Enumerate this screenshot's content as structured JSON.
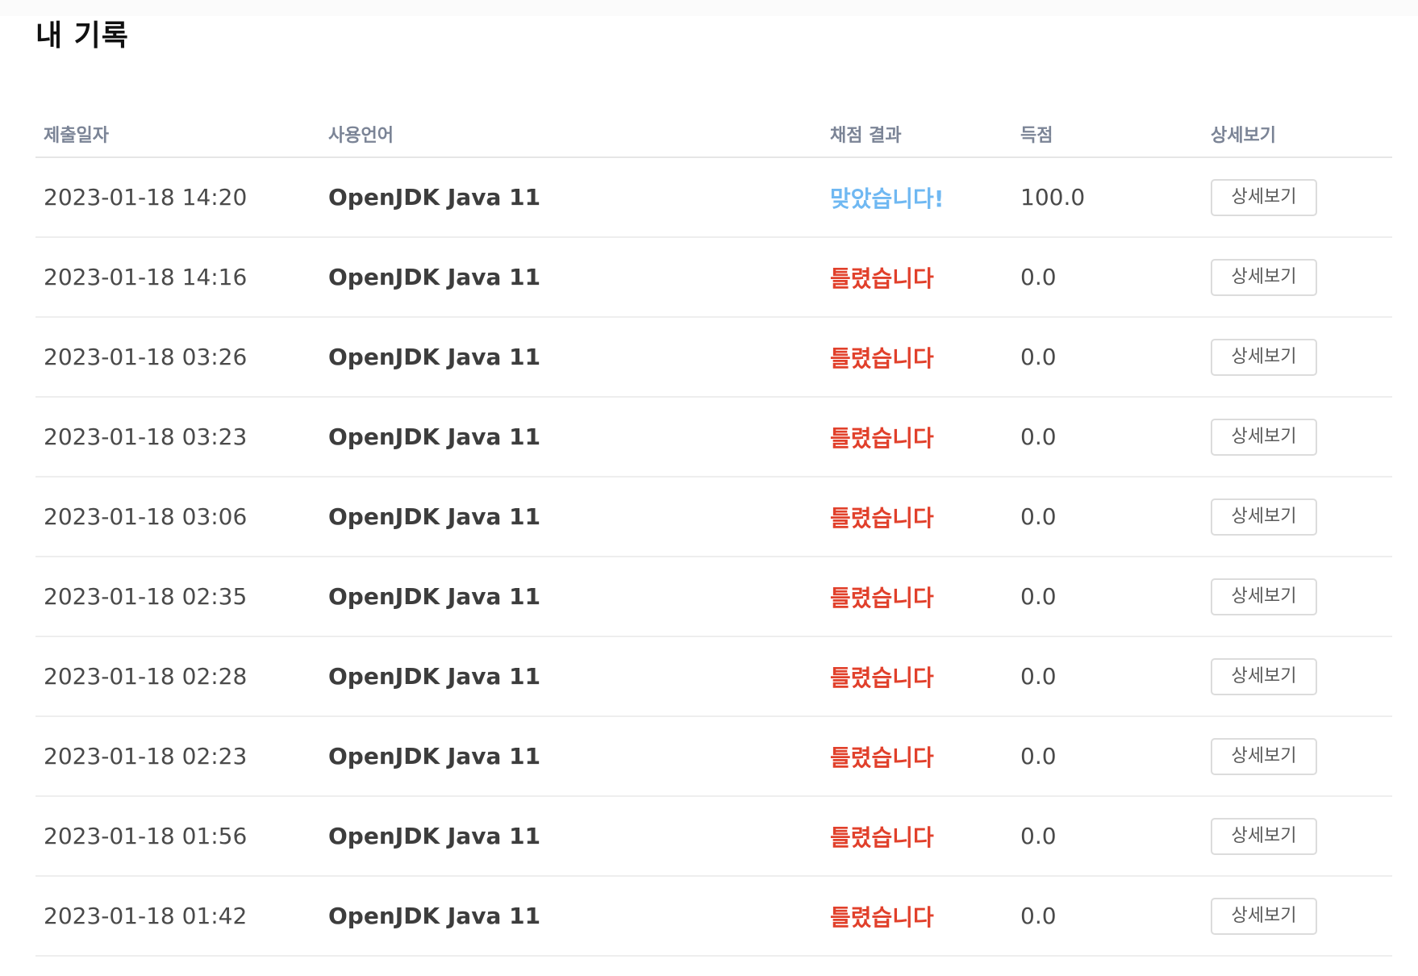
{
  "page": {
    "title": "내 기록"
  },
  "table": {
    "headers": {
      "date": "제출일자",
      "language": "사용언어",
      "result": "채점 결과",
      "score": "득점",
      "detail": "상세보기"
    },
    "rows": [
      {
        "date": "2023-01-18 14:20",
        "language": "OpenJDK Java 11",
        "result": "맞았습니다!",
        "status": "correct",
        "score": "100.0",
        "detail_label": "상세보기"
      },
      {
        "date": "2023-01-18 14:16",
        "language": "OpenJDK Java 11",
        "result": "틀렸습니다",
        "status": "wrong",
        "score": "0.0",
        "detail_label": "상세보기"
      },
      {
        "date": "2023-01-18 03:26",
        "language": "OpenJDK Java 11",
        "result": "틀렸습니다",
        "status": "wrong",
        "score": "0.0",
        "detail_label": "상세보기"
      },
      {
        "date": "2023-01-18 03:23",
        "language": "OpenJDK Java 11",
        "result": "틀렸습니다",
        "status": "wrong",
        "score": "0.0",
        "detail_label": "상세보기"
      },
      {
        "date": "2023-01-18 03:06",
        "language": "OpenJDK Java 11",
        "result": "틀렸습니다",
        "status": "wrong",
        "score": "0.0",
        "detail_label": "상세보기"
      },
      {
        "date": "2023-01-18 02:35",
        "language": "OpenJDK Java 11",
        "result": "틀렸습니다",
        "status": "wrong",
        "score": "0.0",
        "detail_label": "상세보기"
      },
      {
        "date": "2023-01-18 02:28",
        "language": "OpenJDK Java 11",
        "result": "틀렸습니다",
        "status": "wrong",
        "score": "0.0",
        "detail_label": "상세보기"
      },
      {
        "date": "2023-01-18 02:23",
        "language": "OpenJDK Java 11",
        "result": "틀렸습니다",
        "status": "wrong",
        "score": "0.0",
        "detail_label": "상세보기"
      },
      {
        "date": "2023-01-18 01:56",
        "language": "OpenJDK Java 11",
        "result": "틀렸습니다",
        "status": "wrong",
        "score": "0.0",
        "detail_label": "상세보기"
      },
      {
        "date": "2023-01-18 01:42",
        "language": "OpenJDK Java 11",
        "result": "틀렸습니다",
        "status": "wrong",
        "score": "0.0",
        "detail_label": "상세보기"
      }
    ]
  },
  "colors": {
    "correct": "#6fb8f2",
    "wrong": "#e1402b",
    "header_text": "#7b8496"
  }
}
